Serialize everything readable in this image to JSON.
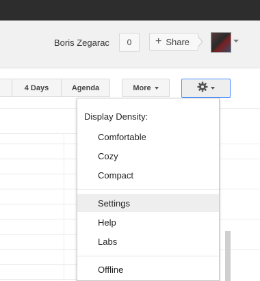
{
  "header": {
    "username": "Boris Zegarac",
    "count": "0",
    "share_label": "Share",
    "share_icon": "plus-icon"
  },
  "toolbar": {
    "four_days_label": "4 Days",
    "agenda_label": "Agenda",
    "more_label": "More",
    "settings_icon": "gear-icon"
  },
  "menu": {
    "heading": "Display Density:",
    "items": [
      {
        "label": "Comfortable"
      },
      {
        "label": "Cozy"
      },
      {
        "label": "Compact"
      },
      {
        "label": "Settings"
      },
      {
        "label": "Help"
      },
      {
        "label": "Labs"
      },
      {
        "label": "Offline"
      }
    ]
  },
  "colors": {
    "topbar": "#2d2d2d",
    "header_bg": "#f1f1f1",
    "accent_border": "#4d90fe",
    "menu_highlight": "#eeeeee"
  }
}
